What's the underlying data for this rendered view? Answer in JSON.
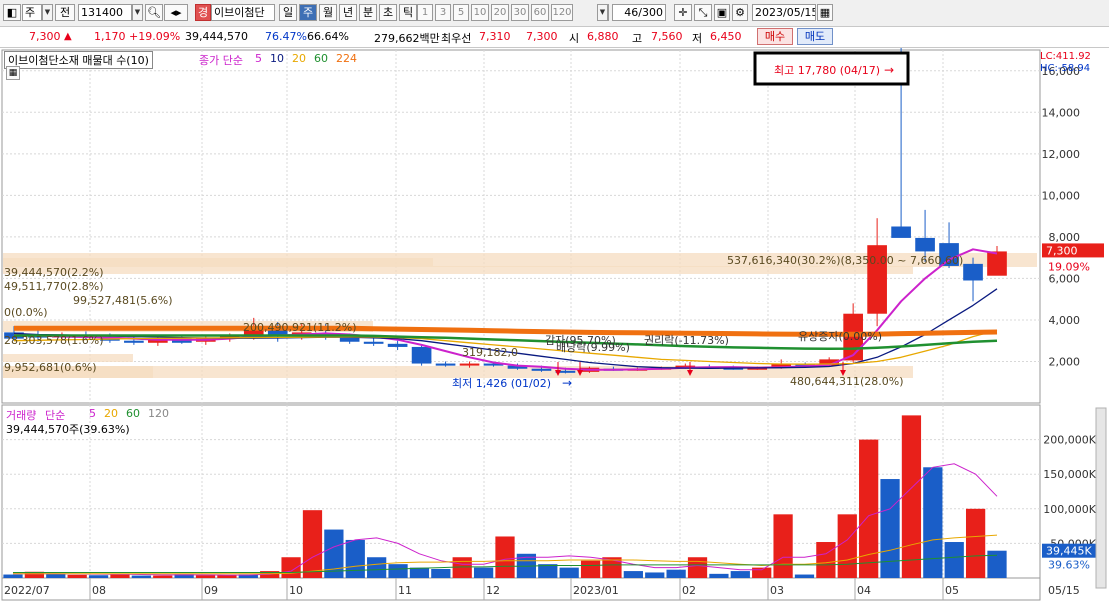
{
  "toolbar": {
    "market_type": "주",
    "prev_label": "전",
    "code": "131400",
    "badge": "경",
    "stock_name": "이브이첨단",
    "periods": [
      "일",
      "주",
      "월",
      "년",
      "분",
      "초",
      "틱"
    ],
    "selected_period": "주",
    "numbers": [
      "1",
      "3",
      "5",
      "10",
      "20",
      "30",
      "60",
      "120"
    ],
    "count": "46/300",
    "date": "2023/05/15"
  },
  "quote": {
    "price": "7,300",
    "arrow": "▲",
    "change": "1,170",
    "change_pct": "+19.09%",
    "volume": "39,444,570",
    "pct1": "76.47%",
    "pct2": "66.64%",
    "amount": "279,662백만",
    "priority_label": "최우선",
    "ask": "7,310",
    "bid": "7,300",
    "open_label": "시",
    "open": "6,880",
    "high_label": "고",
    "high": "7,560",
    "low_label": "저",
    "low": "6,450",
    "buy_label": "매수",
    "sell_label": "매도"
  },
  "price_panel": {
    "indicator_title": "이브이첨단소재 매물대 수(10)",
    "ma_label": "종가 단순",
    "ma_periods": [
      "5",
      "10",
      "20",
      "60",
      "224"
    ],
    "lc": "LC:411.92",
    "hc": "HC:-58.94",
    "high_annotation": "최고 17,780 (04/17)",
    "low_annotation": "최저 1,426 (01/02)",
    "current_price_box": "7,300",
    "current_pct_box": "19.09%",
    "y_ticks": [
      "2,000",
      "4,000",
      "6,000",
      "8,000",
      "10,000",
      "12,000",
      "14,000",
      "16,000"
    ],
    "events": [
      "감자(95.70%)",
      "배당락(9.99%)",
      "권리락(-11.73%)",
      "유상증자(0.00%)"
    ],
    "volume_profile_labels": [
      "537,616,340(30.2%)(8,350.00 ~ 7,660.60)",
      "39,444,570(2.2%)",
      "49,511,770(2.8%)",
      "99,527,481(5.6%)",
      "0(0.0%)",
      "28,303,578(1.6%)",
      "200,490,921(11.2%)",
      "319,182,0",
      "9,952,681(0.6%)",
      "480,644,311(28.0%)"
    ]
  },
  "volume_panel": {
    "title": "거래량",
    "ma_label": "단순",
    "ma_periods": [
      "5",
      "20",
      "60",
      "120"
    ],
    "current_volume": "39,444,570주(39.63%)",
    "y_ticks": [
      "50,000K",
      "100,000K",
      "150,000K",
      "200,000K"
    ],
    "current_box": "39,445K",
    "current_pct": "39.63%"
  },
  "x_axis": [
    "2022/07",
    "08",
    "09",
    "10",
    "11",
    "12",
    "2023/01",
    "02",
    "03",
    "04",
    "05",
    "05/15"
  ],
  "chart_data": [
    {
      "type": "candlestick",
      "title": "",
      "ylim": [
        0,
        17000
      ],
      "ylabel": "",
      "candles": [
        {
          "o": 3400,
          "h": 3700,
          "l": 3000,
          "c": 3100,
          "dir": "down"
        },
        {
          "o": 3300,
          "h": 3500,
          "l": 2950,
          "c": 3150,
          "dir": "down"
        },
        {
          "o": 3200,
          "h": 3400,
          "l": 3050,
          "c": 3250,
          "dir": "up"
        },
        {
          "o": 3250,
          "h": 3450,
          "l": 3050,
          "c": 3150,
          "dir": "down"
        },
        {
          "o": 3150,
          "h": 3350,
          "l": 2900,
          "c": 3000,
          "dir": "down"
        },
        {
          "o": 3000,
          "h": 3200,
          "l": 2800,
          "c": 2900,
          "dir": "down"
        },
        {
          "o": 2900,
          "h": 3200,
          "l": 2750,
          "c": 3100,
          "dir": "up"
        },
        {
          "o": 3100,
          "h": 3250,
          "l": 2850,
          "c": 2900,
          "dir": "down"
        },
        {
          "o": 2950,
          "h": 3200,
          "l": 2800,
          "c": 3150,
          "dir": "up"
        },
        {
          "o": 3100,
          "h": 3350,
          "l": 2950,
          "c": 3300,
          "dir": "up"
        },
        {
          "o": 3200,
          "h": 4100,
          "l": 3050,
          "c": 3700,
          "dir": "up"
        },
        {
          "o": 3700,
          "h": 3900,
          "l": 2950,
          "c": 3200,
          "dir": "down"
        },
        {
          "o": 3200,
          "h": 3800,
          "l": 3050,
          "c": 3400,
          "dir": "up"
        },
        {
          "o": 3350,
          "h": 3800,
          "l": 3050,
          "c": 3150,
          "dir": "down"
        },
        {
          "o": 3150,
          "h": 3350,
          "l": 2850,
          "c": 2950,
          "dir": "down"
        },
        {
          "o": 2950,
          "h": 3150,
          "l": 2750,
          "c": 2850,
          "dir": "down"
        },
        {
          "o": 2850,
          "h": 3000,
          "l": 2550,
          "c": 2700,
          "dir": "down"
        },
        {
          "o": 2700,
          "h": 2800,
          "l": 1800,
          "c": 1900,
          "dir": "down"
        },
        {
          "o": 1900,
          "h": 2000,
          "l": 1750,
          "c": 1800,
          "dir": "down"
        },
        {
          "o": 1800,
          "h": 2000,
          "l": 1700,
          "c": 1900,
          "dir": "up"
        },
        {
          "o": 1900,
          "h": 2000,
          "l": 1750,
          "c": 1800,
          "dir": "down"
        },
        {
          "o": 1800,
          "h": 1900,
          "l": 1600,
          "c": 1650,
          "dir": "down"
        },
        {
          "o": 1650,
          "h": 1800,
          "l": 1500,
          "c": 1550,
          "dir": "down"
        },
        {
          "o": 1550,
          "h": 1700,
          "l": 1426,
          "c": 1500,
          "dir": "down"
        },
        {
          "o": 1500,
          "h": 1750,
          "l": 1450,
          "c": 1700,
          "dir": "up"
        },
        {
          "o": 1650,
          "h": 1750,
          "l": 1550,
          "c": 1600,
          "dir": "down"
        },
        {
          "o": 1600,
          "h": 1700,
          "l": 1550,
          "c": 1650,
          "dir": "up"
        },
        {
          "o": 1650,
          "h": 1750,
          "l": 1600,
          "c": 1700,
          "dir": "up"
        },
        {
          "o": 1700,
          "h": 1900,
          "l": 1650,
          "c": 1800,
          "dir": "up"
        },
        {
          "o": 1750,
          "h": 1850,
          "l": 1650,
          "c": 1700,
          "dir": "down"
        },
        {
          "o": 1700,
          "h": 1800,
          "l": 1600,
          "c": 1650,
          "dir": "down"
        },
        {
          "o": 1650,
          "h": 1750,
          "l": 1600,
          "c": 1700,
          "dir": "up"
        },
        {
          "o": 1700,
          "h": 2100,
          "l": 1650,
          "c": 1900,
          "dir": "up"
        },
        {
          "o": 1850,
          "h": 1950,
          "l": 1700,
          "c": 1800,
          "dir": "down"
        },
        {
          "o": 1800,
          "h": 2200,
          "l": 1750,
          "c": 2100,
          "dir": "up"
        },
        {
          "o": 2050,
          "h": 4800,
          "l": 1950,
          "c": 4300,
          "dir": "up"
        },
        {
          "o": 4300,
          "h": 8900,
          "l": 3700,
          "c": 7600,
          "dir": "up"
        },
        {
          "o": 8500,
          "h": 17780,
          "l": 8000,
          "c": 7950,
          "dir": "down"
        },
        {
          "o": 7950,
          "h": 9300,
          "l": 6800,
          "c": 7300,
          "dir": "down"
        },
        {
          "o": 7700,
          "h": 8700,
          "l": 6500,
          "c": 6600,
          "dir": "down"
        },
        {
          "o": 6700,
          "h": 7000,
          "l": 4900,
          "c": 5900,
          "dir": "down"
        },
        {
          "o": 6130,
          "h": 7560,
          "l": 6450,
          "c": 7300,
          "dir": "up"
        }
      ],
      "series": [
        {
          "name": "5",
          "color": "#cc22cc",
          "values": [
            3300,
            3250,
            3200,
            3180,
            3150,
            3100,
            3050,
            3050,
            3050,
            3100,
            3200,
            3250,
            3300,
            3350,
            3300,
            3200,
            3050,
            2800,
            2500,
            2200,
            1950,
            1800,
            1750,
            1650,
            1600,
            1600,
            1620,
            1650,
            1700,
            1720,
            1730,
            1700,
            1720,
            1770,
            1830,
            2300,
            3500,
            4900,
            6000,
            6900,
            7400,
            7200
          ]
        },
        {
          "name": "10",
          "color": "#0a1a80",
          "values": [
            3350,
            3300,
            3280,
            3250,
            3220,
            3200,
            3180,
            3150,
            3130,
            3120,
            3120,
            3130,
            3150,
            3170,
            3170,
            3140,
            3100,
            3000,
            2850,
            2700,
            2550,
            2400,
            2250,
            2100,
            1950,
            1850,
            1750,
            1700,
            1680,
            1670,
            1680,
            1690,
            1700,
            1720,
            1760,
            1900,
            2200,
            2700,
            3300,
            4000,
            4700,
            5500
          ]
        },
        {
          "name": "20",
          "color": "#e8a800",
          "values": [
            3000,
            3020,
            3040,
            3060,
            3080,
            3100,
            3110,
            3120,
            3130,
            3140,
            3150,
            3160,
            3170,
            3180,
            3190,
            3180,
            3150,
            3100,
            3000,
            2900,
            2800,
            2700,
            2600,
            2500,
            2400,
            2300,
            2200,
            2100,
            2050,
            2000,
            1950,
            1900,
            1880,
            1870,
            1880,
            1900,
            2000,
            2200,
            2500,
            2800,
            3200,
            3500
          ]
        },
        {
          "name": "60",
          "color": "#209030",
          "values": [
            3250,
            3250,
            3250,
            3250,
            3250,
            3250,
            3250,
            3250,
            3250,
            3250,
            3250,
            3250,
            3250,
            3250,
            3250,
            3230,
            3200,
            3170,
            3140,
            3100,
            3060,
            3020,
            2980,
            2940,
            2900,
            2860,
            2820,
            2780,
            2740,
            2710,
            2680,
            2660,
            2640,
            2620,
            2610,
            2620,
            2660,
            2720,
            2800,
            2880,
            2950,
            3000
          ]
        },
        {
          "name": "224",
          "color": "#f07010",
          "values": [
            3600,
            3600,
            3600,
            3600,
            3600,
            3600,
            3600,
            3600,
            3600,
            3600,
            3600,
            3600,
            3600,
            3600,
            3600,
            3580,
            3560,
            3540,
            3520,
            3500,
            3480,
            3460,
            3440,
            3420,
            3400,
            3390,
            3380,
            3370,
            3360,
            3350,
            3340,
            3330,
            3320,
            3310,
            3310,
            3310,
            3320,
            3340,
            3360,
            3380,
            3400,
            3420
          ]
        }
      ]
    },
    {
      "type": "bar",
      "title": "",
      "ylim": [
        0,
        250000
      ],
      "ylabel": "",
      "values": [
        5000,
        9000,
        6000,
        4500,
        4000,
        5000,
        3500,
        3500,
        5500,
        4000,
        3800,
        5000,
        10000,
        30000,
        98000,
        70000,
        55000,
        30000,
        20000,
        15000,
        13000,
        30000,
        15000,
        60000,
        35000,
        20000,
        15000,
        25000,
        30000,
        10000,
        8000,
        12000,
        30000,
        6000,
        10000,
        15000,
        92000,
        5000,
        52000,
        92000,
        200000,
        143000,
        235000,
        160000,
        52000,
        100000,
        39445
      ],
      "dirs": [
        "d",
        "u",
        "d",
        "u",
        "d",
        "u",
        "d",
        "u",
        "d",
        "u",
        "u",
        "d",
        "u",
        "u",
        "u",
        "d",
        "d",
        "d",
        "d",
        "d",
        "d",
        "u",
        "d",
        "u",
        "d",
        "d",
        "d",
        "u",
        "u",
        "d",
        "d",
        "d",
        "u",
        "d",
        "d",
        "u",
        "u",
        "d",
        "u",
        "u",
        "u",
        "d",
        "u",
        "d",
        "d",
        "u",
        "d"
      ],
      "series": [
        {
          "name": "5",
          "color": "#cc22cc",
          "values": [
            6000,
            6000,
            6000,
            5800,
            5600,
            5500,
            5000,
            4500,
            4500,
            4500,
            4200,
            4400,
            5500,
            10000,
            30000,
            45000,
            55000,
            58000,
            50000,
            35000,
            25000,
            20000,
            20000,
            27000,
            30000,
            30000,
            32000,
            30000,
            26000,
            20000,
            15000,
            15000,
            18000,
            15000,
            12000,
            12000,
            30000,
            30000,
            35000,
            55000,
            90000,
            100000,
            130000,
            160000,
            165000,
            150000,
            118000
          ]
        },
        {
          "name": "20",
          "color": "#e8a800",
          "values": [
            6000,
            6000,
            6000,
            6000,
            6000,
            6000,
            6000,
            6000,
            6000,
            6000,
            6000,
            6000,
            6000,
            7000,
            10000,
            13000,
            17000,
            20000,
            22000,
            23000,
            23000,
            24000,
            24000,
            25000,
            25000,
            25000,
            26000,
            26000,
            26000,
            26000,
            25000,
            24000,
            24000,
            22000,
            20000,
            18000,
            20000,
            20000,
            22000,
            26000,
            34000,
            40000,
            48000,
            55000,
            58000,
            60000,
            62000
          ]
        },
        {
          "name": "60",
          "color": "#209030",
          "values": [
            8000,
            8000,
            8000,
            8000,
            8000,
            8000,
            8000,
            8000,
            8000,
            8000,
            8000,
            8000,
            8000,
            8000,
            9000,
            10000,
            11000,
            12000,
            13000,
            14000,
            15000,
            16000,
            16000,
            17000,
            17000,
            18000,
            18000,
            18000,
            19000,
            19000,
            19000,
            19000,
            19000,
            19000,
            19000,
            19000,
            19000,
            19000,
            19000,
            20000,
            22000,
            24000,
            26000,
            28000,
            30000,
            32000,
            33000
          ]
        }
      ]
    }
  ]
}
